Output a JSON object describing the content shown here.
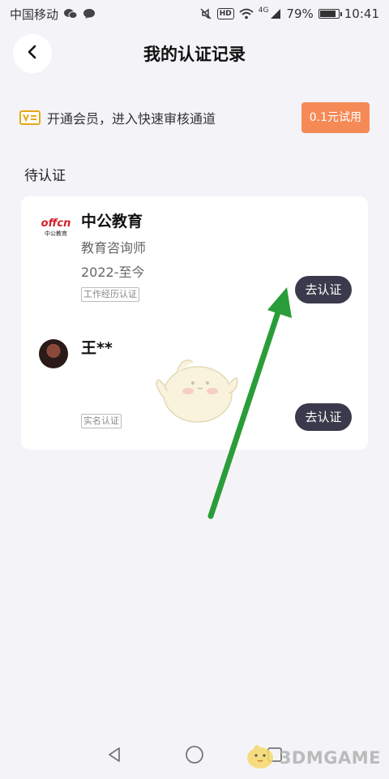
{
  "status_bar": {
    "carrier": "中国移动",
    "network": "4G",
    "hd": "HD",
    "battery_percent": "79%",
    "battery_level": 0.79,
    "time": "10:41"
  },
  "header": {
    "back_icon": "chevron-left-icon",
    "title": "我的认证记录"
  },
  "member_banner": {
    "icon": "vip-icon",
    "text": "开通会员，进入快速审核通道",
    "trial_button": "0.1元试用",
    "trial_color": "#f58a57"
  },
  "section": {
    "title": "待认证"
  },
  "pending_items": [
    {
      "logo_top": "offcn",
      "logo_bottom": "中公教育",
      "name": "中公教育",
      "position": "教育咨询师",
      "period": "2022-至今",
      "tag": "工作经历认证",
      "action": "去认证"
    },
    {
      "name": "王**",
      "tag": "实名认证",
      "action": "去认证"
    }
  ],
  "watermark": {
    "text": "3DMGAME"
  },
  "colors": {
    "button_dark": "#3a3a4c",
    "arrow_green": "#2a9d3a",
    "background": "#f4f4f8"
  }
}
